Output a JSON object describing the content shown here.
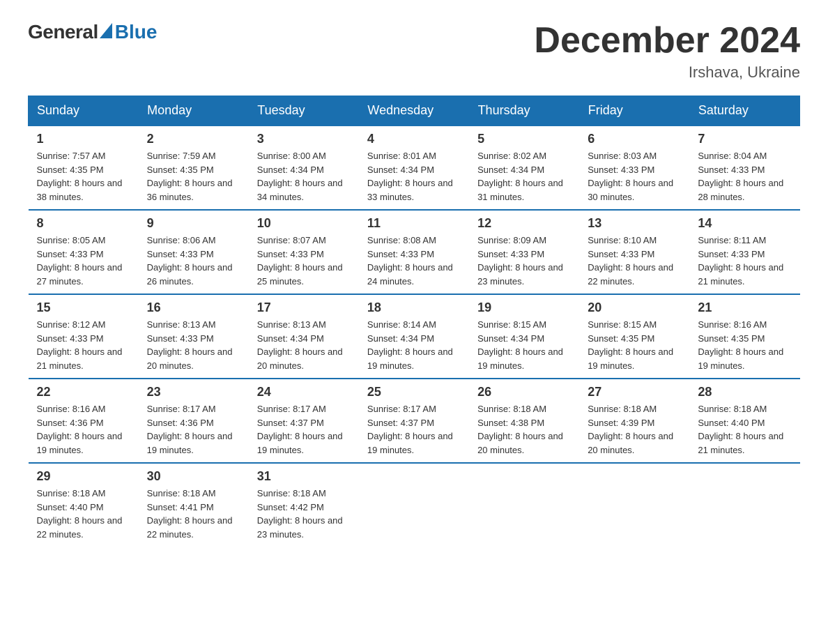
{
  "logo": {
    "general": "General",
    "blue": "Blue"
  },
  "title": "December 2024",
  "location": "Irshava, Ukraine",
  "days_of_week": [
    "Sunday",
    "Monday",
    "Tuesday",
    "Wednesday",
    "Thursday",
    "Friday",
    "Saturday"
  ],
  "weeks": [
    [
      {
        "day": "1",
        "sunrise": "7:57 AM",
        "sunset": "4:35 PM",
        "daylight": "8 hours and 38 minutes."
      },
      {
        "day": "2",
        "sunrise": "7:59 AM",
        "sunset": "4:35 PM",
        "daylight": "8 hours and 36 minutes."
      },
      {
        "day": "3",
        "sunrise": "8:00 AM",
        "sunset": "4:34 PM",
        "daylight": "8 hours and 34 minutes."
      },
      {
        "day": "4",
        "sunrise": "8:01 AM",
        "sunset": "4:34 PM",
        "daylight": "8 hours and 33 minutes."
      },
      {
        "day": "5",
        "sunrise": "8:02 AM",
        "sunset": "4:34 PM",
        "daylight": "8 hours and 31 minutes."
      },
      {
        "day": "6",
        "sunrise": "8:03 AM",
        "sunset": "4:33 PM",
        "daylight": "8 hours and 30 minutes."
      },
      {
        "day": "7",
        "sunrise": "8:04 AM",
        "sunset": "4:33 PM",
        "daylight": "8 hours and 28 minutes."
      }
    ],
    [
      {
        "day": "8",
        "sunrise": "8:05 AM",
        "sunset": "4:33 PM",
        "daylight": "8 hours and 27 minutes."
      },
      {
        "day": "9",
        "sunrise": "8:06 AM",
        "sunset": "4:33 PM",
        "daylight": "8 hours and 26 minutes."
      },
      {
        "day": "10",
        "sunrise": "8:07 AM",
        "sunset": "4:33 PM",
        "daylight": "8 hours and 25 minutes."
      },
      {
        "day": "11",
        "sunrise": "8:08 AM",
        "sunset": "4:33 PM",
        "daylight": "8 hours and 24 minutes."
      },
      {
        "day": "12",
        "sunrise": "8:09 AM",
        "sunset": "4:33 PM",
        "daylight": "8 hours and 23 minutes."
      },
      {
        "day": "13",
        "sunrise": "8:10 AM",
        "sunset": "4:33 PM",
        "daylight": "8 hours and 22 minutes."
      },
      {
        "day": "14",
        "sunrise": "8:11 AM",
        "sunset": "4:33 PM",
        "daylight": "8 hours and 21 minutes."
      }
    ],
    [
      {
        "day": "15",
        "sunrise": "8:12 AM",
        "sunset": "4:33 PM",
        "daylight": "8 hours and 21 minutes."
      },
      {
        "day": "16",
        "sunrise": "8:13 AM",
        "sunset": "4:33 PM",
        "daylight": "8 hours and 20 minutes."
      },
      {
        "day": "17",
        "sunrise": "8:13 AM",
        "sunset": "4:34 PM",
        "daylight": "8 hours and 20 minutes."
      },
      {
        "day": "18",
        "sunrise": "8:14 AM",
        "sunset": "4:34 PM",
        "daylight": "8 hours and 19 minutes."
      },
      {
        "day": "19",
        "sunrise": "8:15 AM",
        "sunset": "4:34 PM",
        "daylight": "8 hours and 19 minutes."
      },
      {
        "day": "20",
        "sunrise": "8:15 AM",
        "sunset": "4:35 PM",
        "daylight": "8 hours and 19 minutes."
      },
      {
        "day": "21",
        "sunrise": "8:16 AM",
        "sunset": "4:35 PM",
        "daylight": "8 hours and 19 minutes."
      }
    ],
    [
      {
        "day": "22",
        "sunrise": "8:16 AM",
        "sunset": "4:36 PM",
        "daylight": "8 hours and 19 minutes."
      },
      {
        "day": "23",
        "sunrise": "8:17 AM",
        "sunset": "4:36 PM",
        "daylight": "8 hours and 19 minutes."
      },
      {
        "day": "24",
        "sunrise": "8:17 AM",
        "sunset": "4:37 PM",
        "daylight": "8 hours and 19 minutes."
      },
      {
        "day": "25",
        "sunrise": "8:17 AM",
        "sunset": "4:37 PM",
        "daylight": "8 hours and 19 minutes."
      },
      {
        "day": "26",
        "sunrise": "8:18 AM",
        "sunset": "4:38 PM",
        "daylight": "8 hours and 20 minutes."
      },
      {
        "day": "27",
        "sunrise": "8:18 AM",
        "sunset": "4:39 PM",
        "daylight": "8 hours and 20 minutes."
      },
      {
        "day": "28",
        "sunrise": "8:18 AM",
        "sunset": "4:40 PM",
        "daylight": "8 hours and 21 minutes."
      }
    ],
    [
      {
        "day": "29",
        "sunrise": "8:18 AM",
        "sunset": "4:40 PM",
        "daylight": "8 hours and 22 minutes."
      },
      {
        "day": "30",
        "sunrise": "8:18 AM",
        "sunset": "4:41 PM",
        "daylight": "8 hours and 22 minutes."
      },
      {
        "day": "31",
        "sunrise": "8:18 AM",
        "sunset": "4:42 PM",
        "daylight": "8 hours and 23 minutes."
      },
      null,
      null,
      null,
      null
    ]
  ],
  "labels": {
    "sunrise": "Sunrise:",
    "sunset": "Sunset:",
    "daylight": "Daylight:"
  }
}
